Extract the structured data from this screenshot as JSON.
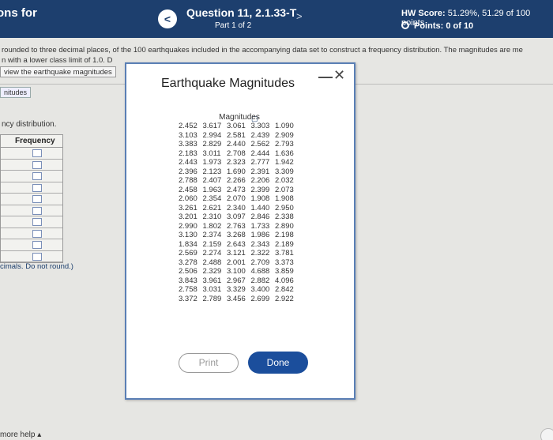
{
  "header": {
    "left_title": "ons for",
    "prev": "<",
    "question_title": "Question 11, 2.1.33-T",
    "part": "Part 1 of 2",
    "next": ">",
    "hw_score_label": "HW Score:",
    "hw_score_value": "51.29%, 51.29 of 100 points",
    "points": "Points: 0 of 10"
  },
  "question": {
    "instruction_line1": "rounded to three decimal places, of the 100 earthquakes included in the accompanying data set to construct a frequency distribution. The magnitudes are me",
    "instruction_line2": "n with a lower class limit of 1.0. D",
    "view_link": "view the earthquake magnitudes",
    "tag": "nitudes",
    "freq_dist_label": "ncy distribution.",
    "freq_header": "Frequency",
    "round_note_prefix": "cimals.",
    "round_note": "Do not round.)",
    "more_help": "more help ▴"
  },
  "modal": {
    "title": "Earthquake Magnitudes",
    "minimize": "—",
    "close": "✕",
    "column_header": "Magnitudes",
    "copy_icon": "▢",
    "rows": [
      [
        "2.452",
        "3.617",
        "3.061",
        "3.303",
        "1.090"
      ],
      [
        "3.103",
        "2.994",
        "2.581",
        "2.439",
        "2.909"
      ],
      [
        "3.383",
        "2.829",
        "2.440",
        "2.562",
        "2.793"
      ],
      [
        "2.183",
        "3.011",
        "2.708",
        "2.444",
        "1.636"
      ],
      [
        "2.443",
        "1.973",
        "2.323",
        "2.777",
        "1.942"
      ],
      [
        "2.396",
        "2.123",
        "1.690",
        "2.391",
        "3.309"
      ],
      [
        "2.788",
        "2.407",
        "2.266",
        "2.206",
        "2.032"
      ],
      [
        "2.458",
        "1.963",
        "2.473",
        "2.399",
        "2.073"
      ],
      [
        "2.060",
        "2.354",
        "2.070",
        "1.908",
        "1.908"
      ],
      [
        "3.261",
        "2.621",
        "2.340",
        "1.440",
        "2.950"
      ],
      [
        "3.201",
        "2.310",
        "3.097",
        "2.846",
        "2.338"
      ],
      [
        "2.990",
        "1.802",
        "2.763",
        "1.733",
        "2.890"
      ],
      [
        "3.130",
        "2.374",
        "3.268",
        "1.986",
        "2.198"
      ],
      [
        "1.834",
        "2.159",
        "2.643",
        "2.343",
        "2.189"
      ],
      [
        "2.569",
        "2.274",
        "3.121",
        "2.322",
        "3.781"
      ],
      [
        "3.278",
        "2.488",
        "2.001",
        "2.709",
        "3.373"
      ],
      [
        "2.506",
        "2.329",
        "3.100",
        "4.688",
        "3.859"
      ],
      [
        "3.843",
        "3.961",
        "2.967",
        "2.882",
        "4.096"
      ],
      [
        "2.758",
        "3.031",
        "3.329",
        "3.400",
        "2.842"
      ],
      [
        "3.372",
        "2.789",
        "3.456",
        "2.699",
        "2.922"
      ]
    ],
    "print_label": "Print",
    "done_label": "Done"
  }
}
